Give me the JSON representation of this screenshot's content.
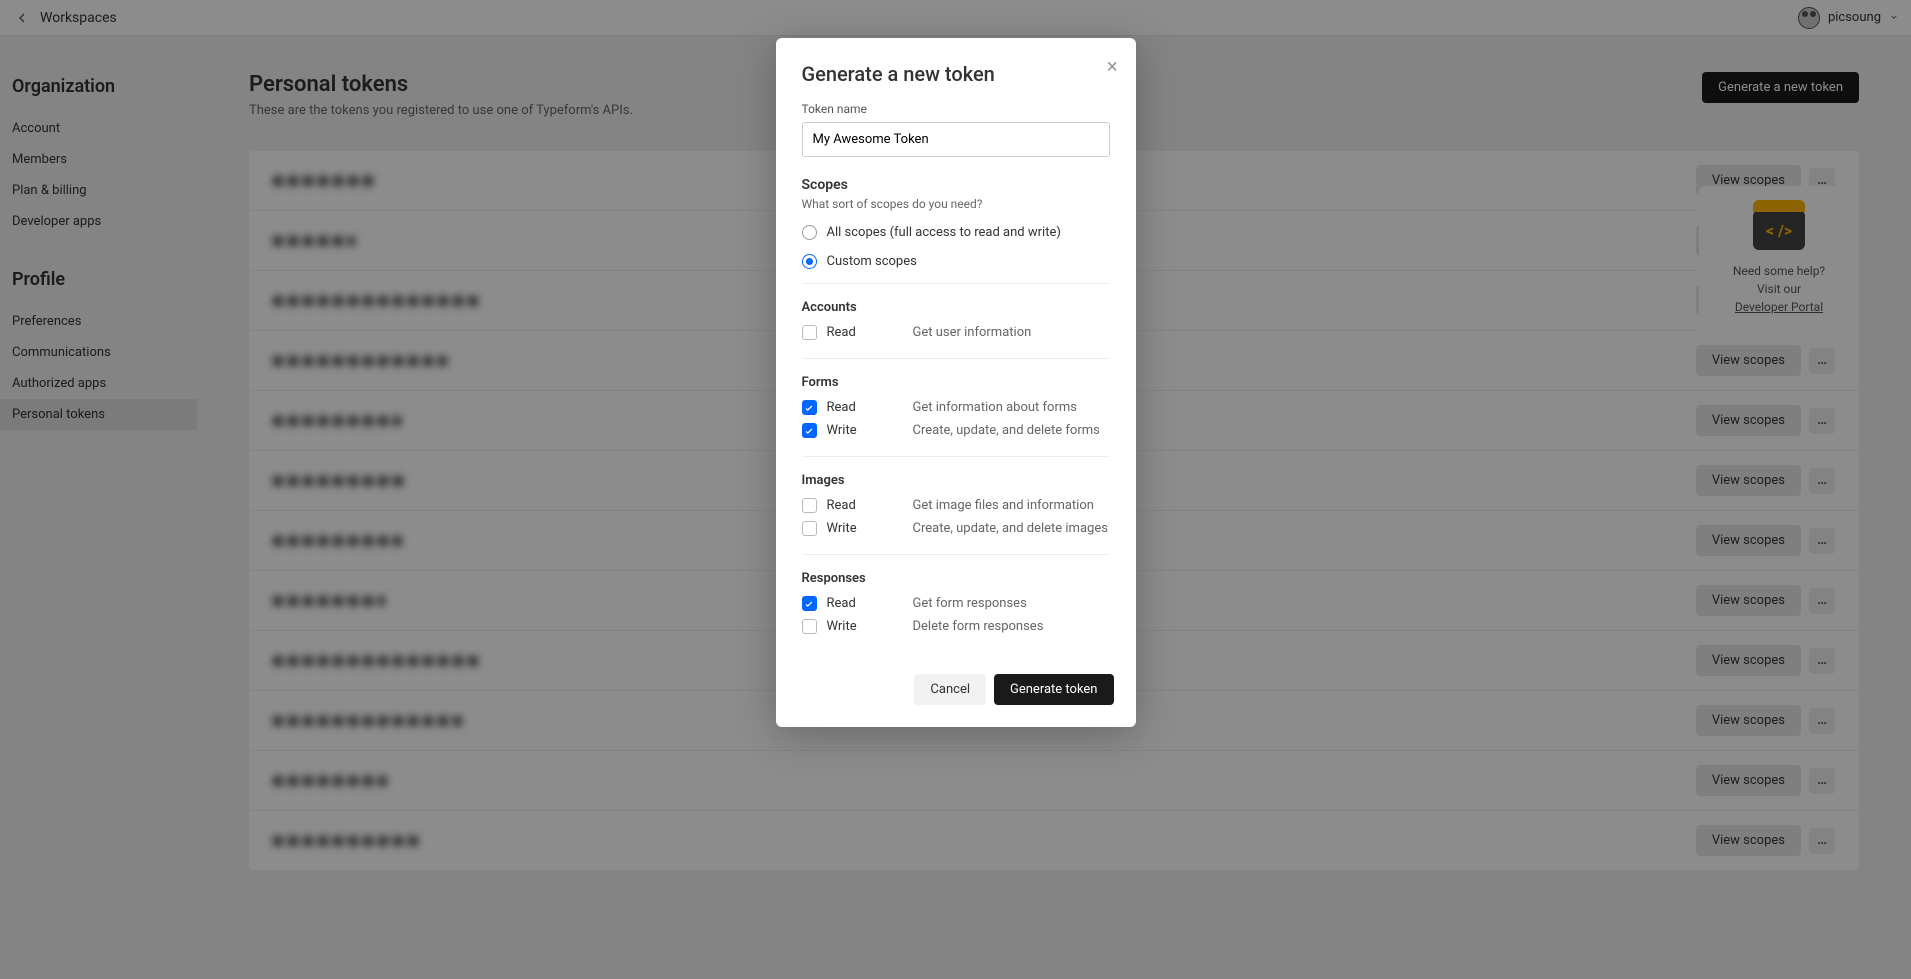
{
  "topbar": {
    "back_label": "Workspaces",
    "username": "picsoung"
  },
  "sidebar": {
    "org_title": "Organization",
    "org_items": [
      "Account",
      "Members",
      "Plan & billing",
      "Developer apps"
    ],
    "profile_title": "Profile",
    "profile_items": [
      "Preferences",
      "Communications",
      "Authorized apps",
      "Personal tokens"
    ],
    "active_index": 3
  },
  "page": {
    "title": "Personal tokens",
    "subtitle": "These are the tokens you registered to use one of Typeform's APIs.",
    "generate_button": "Generate a new token",
    "view_scopes": "View scopes"
  },
  "tokens_count": 12,
  "help": {
    "line1": "Need some help?",
    "line2": "Visit our",
    "link": "Developer Portal",
    "icon_glyph": "< />"
  },
  "modal": {
    "title": "Generate a new token",
    "token_name_label": "Token name",
    "token_name_value": "My Awesome Token",
    "scopes_heading": "Scopes",
    "scopes_sub": "What sort of scopes do you need?",
    "radio_all": "All scopes (full access to read and write)",
    "radio_custom": "Custom scopes",
    "radio_selected": "custom",
    "groups": [
      {
        "title": "Accounts",
        "rows": [
          {
            "action": "Read",
            "desc": "Get user information",
            "checked": false
          }
        ]
      },
      {
        "title": "Forms",
        "rows": [
          {
            "action": "Read",
            "desc": "Get information about forms",
            "checked": true
          },
          {
            "action": "Write",
            "desc": "Create, update, and delete forms",
            "checked": true
          }
        ]
      },
      {
        "title": "Images",
        "rows": [
          {
            "action": "Read",
            "desc": "Get image files and information",
            "checked": false
          },
          {
            "action": "Write",
            "desc": "Create, update, and delete images",
            "checked": false
          }
        ]
      },
      {
        "title": "Responses",
        "rows": [
          {
            "action": "Read",
            "desc": "Get form responses",
            "checked": true
          },
          {
            "action": "Write",
            "desc": "Delete form responses",
            "checked": false
          }
        ]
      }
    ],
    "cancel": "Cancel",
    "generate": "Generate token"
  }
}
